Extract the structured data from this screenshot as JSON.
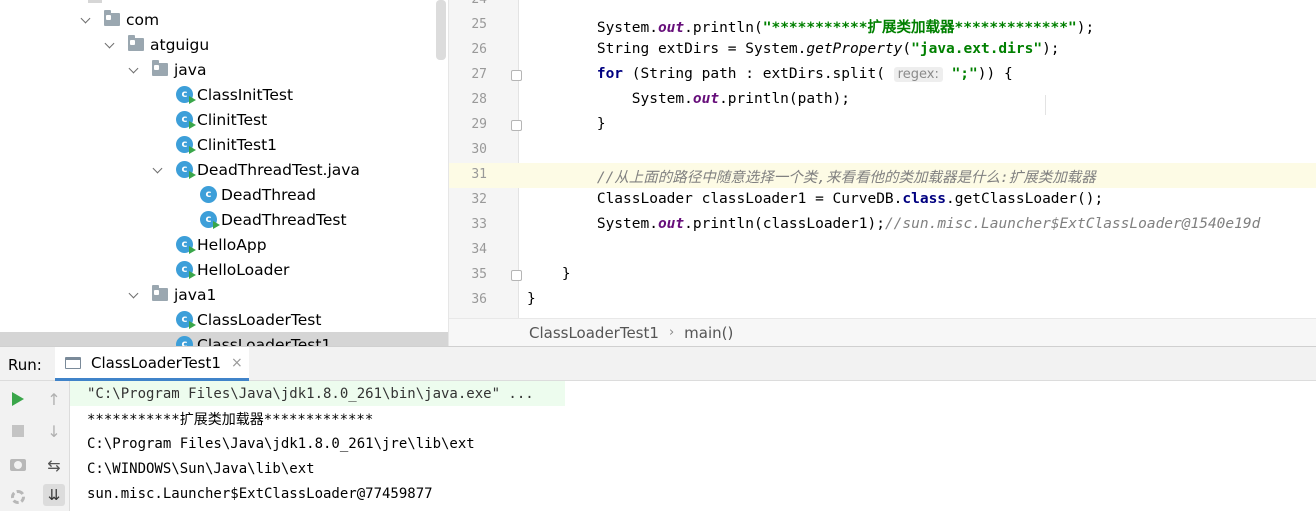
{
  "tree": {
    "items": [
      {
        "label": "com",
        "type": "folder",
        "depth": 0,
        "expanded": true
      },
      {
        "label": "atguigu",
        "type": "folder",
        "depth": 1,
        "expanded": true
      },
      {
        "label": "java",
        "type": "folder",
        "depth": 2,
        "expanded": true
      },
      {
        "label": "ClassInitTest",
        "type": "class-run",
        "depth": 3
      },
      {
        "label": "ClinitTest",
        "type": "class-run",
        "depth": 3
      },
      {
        "label": "ClinitTest1",
        "type": "class-run",
        "depth": 3
      },
      {
        "label": "DeadThreadTest.java",
        "type": "class-run",
        "depth": 3,
        "expanded": true
      },
      {
        "label": "DeadThread",
        "type": "class",
        "depth": 4
      },
      {
        "label": "DeadThreadTest",
        "type": "class-run",
        "depth": 4
      },
      {
        "label": "HelloApp",
        "type": "class-run",
        "depth": 3
      },
      {
        "label": "HelloLoader",
        "type": "class-run",
        "depth": 3
      },
      {
        "label": "java1",
        "type": "folder",
        "depth": 2,
        "expanded": true
      },
      {
        "label": "ClassLoaderTest",
        "type": "class-run",
        "depth": 3
      },
      {
        "label": "ClassLoaderTest1",
        "type": "class-run",
        "depth": 3,
        "selected": true
      }
    ]
  },
  "editor": {
    "lines": [
      {
        "num": "24",
        "segments": []
      },
      {
        "num": "25",
        "segments": [
          {
            "t": "        System."
          },
          {
            "t": "out",
            "c": "field"
          },
          {
            "t": ".println("
          },
          {
            "t": "\"***********扩展类加载器*************\"",
            "c": "str"
          },
          {
            "t": ");"
          }
        ]
      },
      {
        "num": "26",
        "segments": [
          {
            "t": "        String extDirs = System."
          },
          {
            "t": "getProperty",
            "c": "mcall"
          },
          {
            "t": "("
          },
          {
            "t": "\"java.ext.dirs\"",
            "c": "str"
          },
          {
            "t": ");"
          }
        ]
      },
      {
        "num": "27",
        "fold": true,
        "segments": [
          {
            "t": "        "
          },
          {
            "t": "for",
            "c": "kw"
          },
          {
            "t": " (String path : extDirs.split( "
          },
          {
            "t": "regex:",
            "c": "hint"
          },
          {
            "t": " "
          },
          {
            "t": "\";\"",
            "c": "str"
          },
          {
            "t": ")) {"
          }
        ]
      },
      {
        "num": "28",
        "segments": [
          {
            "t": "            System."
          },
          {
            "t": "out",
            "c": "field"
          },
          {
            "t": ".println(path);"
          }
        ]
      },
      {
        "num": "29",
        "fold": true,
        "segments": [
          {
            "t": "        }"
          }
        ]
      },
      {
        "num": "30",
        "segments": []
      },
      {
        "num": "31",
        "current": true,
        "segments": [
          {
            "t": "        "
          },
          {
            "t": "//从上面的路径中随意选择一个类,来看看他的类加载器是什么:扩展类加载器",
            "c": "cmt"
          }
        ]
      },
      {
        "num": "32",
        "segments": [
          {
            "t": "        ClassLoader classLoader1 = CurveDB."
          },
          {
            "t": "class",
            "c": "kw"
          },
          {
            "t": ".getClassLoader();"
          }
        ]
      },
      {
        "num": "33",
        "segments": [
          {
            "t": "        System."
          },
          {
            "t": "out",
            "c": "field"
          },
          {
            "t": ".println(classLoader1);"
          },
          {
            "t": "//sun.misc.Launcher$ExtClassLoader@1540e19d",
            "c": "cmt"
          }
        ]
      },
      {
        "num": "34",
        "segments": []
      },
      {
        "num": "35",
        "fold": true,
        "segments": [
          {
            "t": "    }"
          }
        ]
      },
      {
        "num": "36",
        "segments": [
          {
            "t": "}"
          }
        ]
      }
    ]
  },
  "breadcrumb": {
    "class": "ClassLoaderTest1",
    "separator": "›",
    "method": "main()"
  },
  "run": {
    "label": "Run:",
    "tab_label": "ClassLoaderTest1",
    "tab_close": "×",
    "toolbar": {
      "up_glyph": "↑",
      "down_glyph": "↓",
      "wrap_glyph": "⇆",
      "scroll_end_glyph": "⇊"
    },
    "console_lines": [
      "\"C:\\Program Files\\Java\\jdk1.8.0_261\\bin\\java.exe\" ...",
      "***********扩展类加载器*************",
      "C:\\Program Files\\Java\\jdk1.8.0_261\\jre\\lib\\ext",
      "C:\\WINDOWS\\Sun\\Java\\lib\\ext",
      "sun.misc.Launcher$ExtClassLoader@77459877"
    ]
  },
  "colors": {
    "keyword": "#000080",
    "field": "#660e7a",
    "string": "#008000",
    "comment": "#808080",
    "class_icon": "#3d9fd9",
    "run_green": "#3aa64a",
    "tab_underline": "#4083c9"
  },
  "icons": {
    "folder": "package-folder-icon",
    "class": "java-class-icon",
    "play": "rerun-play-icon",
    "stop": "stop-icon",
    "camera": "dump-threads-icon",
    "settings": "settings-icon"
  }
}
